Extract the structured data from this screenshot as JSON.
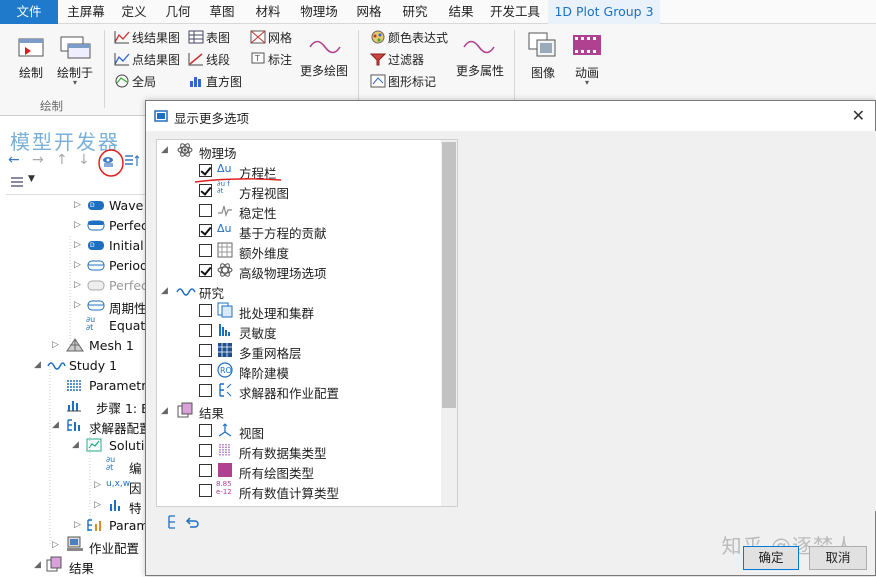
{
  "ribbon_tabs": [
    "文件",
    "主屏幕",
    "定义",
    "几何",
    "草图",
    "材料",
    "物理场",
    "网格",
    "研究",
    "结果",
    "开发工具",
    "1D Plot Group 3"
  ],
  "ribbon": {
    "plot": "绘制",
    "plot_to": "绘制于",
    "group_plot": "绘制",
    "line_graph": "线结果图",
    "point_graph": "点结果图",
    "global": "全局",
    "table": "表图",
    "line_seg": "线段",
    "histogram": "直方图",
    "mesh": "网格",
    "annotation": "标注",
    "more_plots": "更多绘图",
    "color_expr": "颜色表达式",
    "filter": "过滤器",
    "graph_marker": "图形标记",
    "more_attrs": "更多属性",
    "image": "图像",
    "animation": "动画"
  },
  "model_builder": {
    "title": "模型开发器",
    "tree": [
      "Wave",
      "Perfec",
      "Initial",
      "Period",
      "Perfec",
      "周期性",
      "Equatio",
      "Mesh 1",
      "Study 1",
      "Parametri",
      "步骤 1: E",
      "求解器配置",
      "Solutio",
      "编",
      "因",
      "特",
      "Param",
      "作业配置",
      "结果"
    ]
  },
  "dialog": {
    "title": "显示更多选项",
    "close": "✕",
    "categories": {
      "physics": "物理场",
      "study": "研究",
      "results": "结果"
    },
    "physics_options": [
      {
        "label": "方程栏",
        "checked": true
      },
      {
        "label": "方程视图",
        "checked": true
      },
      {
        "label": "稳定性",
        "checked": false
      },
      {
        "label": "基于方程的贡献",
        "checked": true
      },
      {
        "label": "额外维度",
        "checked": false
      },
      {
        "label": "高级物理场选项",
        "checked": true
      }
    ],
    "study_options": [
      {
        "label": "批处理和集群",
        "checked": false
      },
      {
        "label": "灵敏度",
        "checked": false
      },
      {
        "label": "多重网格层",
        "checked": false
      },
      {
        "label": "降阶建模",
        "checked": false
      },
      {
        "label": "求解器和作业配置",
        "checked": false
      }
    ],
    "results_options": [
      {
        "label": "视图",
        "checked": false
      },
      {
        "label": "所有数据集类型",
        "checked": false
      },
      {
        "label": "所有绘图类型",
        "checked": false
      },
      {
        "label": "所有数值计算类型",
        "checked": false
      }
    ],
    "ok": "确定",
    "cancel": "取消"
  },
  "watermark": "知乎 @逐梦人",
  "colors": {
    "accent": "#1f7acb",
    "annotation": "#e02020"
  }
}
